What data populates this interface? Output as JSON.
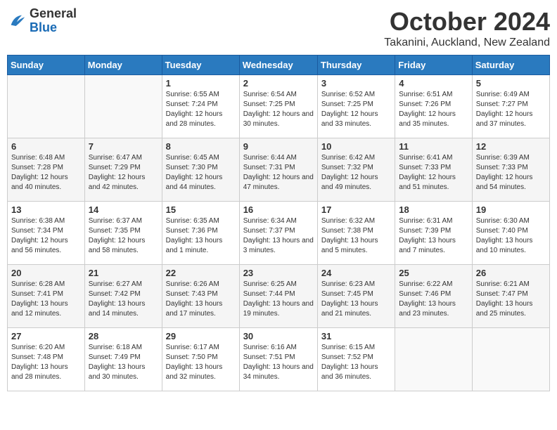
{
  "header": {
    "logo_general": "General",
    "logo_blue": "Blue",
    "month_title": "October 2024",
    "location": "Takanini, Auckland, New Zealand"
  },
  "weekdays": [
    "Sunday",
    "Monday",
    "Tuesday",
    "Wednesday",
    "Thursday",
    "Friday",
    "Saturday"
  ],
  "weeks": [
    [
      {
        "day": "",
        "sunrise": "",
        "sunset": "",
        "daylight": ""
      },
      {
        "day": "",
        "sunrise": "",
        "sunset": "",
        "daylight": ""
      },
      {
        "day": "1",
        "sunrise": "Sunrise: 6:55 AM",
        "sunset": "Sunset: 7:24 PM",
        "daylight": "Daylight: 12 hours and 28 minutes."
      },
      {
        "day": "2",
        "sunrise": "Sunrise: 6:54 AM",
        "sunset": "Sunset: 7:25 PM",
        "daylight": "Daylight: 12 hours and 30 minutes."
      },
      {
        "day": "3",
        "sunrise": "Sunrise: 6:52 AM",
        "sunset": "Sunset: 7:25 PM",
        "daylight": "Daylight: 12 hours and 33 minutes."
      },
      {
        "day": "4",
        "sunrise": "Sunrise: 6:51 AM",
        "sunset": "Sunset: 7:26 PM",
        "daylight": "Daylight: 12 hours and 35 minutes."
      },
      {
        "day": "5",
        "sunrise": "Sunrise: 6:49 AM",
        "sunset": "Sunset: 7:27 PM",
        "daylight": "Daylight: 12 hours and 37 minutes."
      }
    ],
    [
      {
        "day": "6",
        "sunrise": "Sunrise: 6:48 AM",
        "sunset": "Sunset: 7:28 PM",
        "daylight": "Daylight: 12 hours and 40 minutes."
      },
      {
        "day": "7",
        "sunrise": "Sunrise: 6:47 AM",
        "sunset": "Sunset: 7:29 PM",
        "daylight": "Daylight: 12 hours and 42 minutes."
      },
      {
        "day": "8",
        "sunrise": "Sunrise: 6:45 AM",
        "sunset": "Sunset: 7:30 PM",
        "daylight": "Daylight: 12 hours and 44 minutes."
      },
      {
        "day": "9",
        "sunrise": "Sunrise: 6:44 AM",
        "sunset": "Sunset: 7:31 PM",
        "daylight": "Daylight: 12 hours and 47 minutes."
      },
      {
        "day": "10",
        "sunrise": "Sunrise: 6:42 AM",
        "sunset": "Sunset: 7:32 PM",
        "daylight": "Daylight: 12 hours and 49 minutes."
      },
      {
        "day": "11",
        "sunrise": "Sunrise: 6:41 AM",
        "sunset": "Sunset: 7:33 PM",
        "daylight": "Daylight: 12 hours and 51 minutes."
      },
      {
        "day": "12",
        "sunrise": "Sunrise: 6:39 AM",
        "sunset": "Sunset: 7:33 PM",
        "daylight": "Daylight: 12 hours and 54 minutes."
      }
    ],
    [
      {
        "day": "13",
        "sunrise": "Sunrise: 6:38 AM",
        "sunset": "Sunset: 7:34 PM",
        "daylight": "Daylight: 12 hours and 56 minutes."
      },
      {
        "day": "14",
        "sunrise": "Sunrise: 6:37 AM",
        "sunset": "Sunset: 7:35 PM",
        "daylight": "Daylight: 12 hours and 58 minutes."
      },
      {
        "day": "15",
        "sunrise": "Sunrise: 6:35 AM",
        "sunset": "Sunset: 7:36 PM",
        "daylight": "Daylight: 13 hours and 1 minute."
      },
      {
        "day": "16",
        "sunrise": "Sunrise: 6:34 AM",
        "sunset": "Sunset: 7:37 PM",
        "daylight": "Daylight: 13 hours and 3 minutes."
      },
      {
        "day": "17",
        "sunrise": "Sunrise: 6:32 AM",
        "sunset": "Sunset: 7:38 PM",
        "daylight": "Daylight: 13 hours and 5 minutes."
      },
      {
        "day": "18",
        "sunrise": "Sunrise: 6:31 AM",
        "sunset": "Sunset: 7:39 PM",
        "daylight": "Daylight: 13 hours and 7 minutes."
      },
      {
        "day": "19",
        "sunrise": "Sunrise: 6:30 AM",
        "sunset": "Sunset: 7:40 PM",
        "daylight": "Daylight: 13 hours and 10 minutes."
      }
    ],
    [
      {
        "day": "20",
        "sunrise": "Sunrise: 6:28 AM",
        "sunset": "Sunset: 7:41 PM",
        "daylight": "Daylight: 13 hours and 12 minutes."
      },
      {
        "day": "21",
        "sunrise": "Sunrise: 6:27 AM",
        "sunset": "Sunset: 7:42 PM",
        "daylight": "Daylight: 13 hours and 14 minutes."
      },
      {
        "day": "22",
        "sunrise": "Sunrise: 6:26 AM",
        "sunset": "Sunset: 7:43 PM",
        "daylight": "Daylight: 13 hours and 17 minutes."
      },
      {
        "day": "23",
        "sunrise": "Sunrise: 6:25 AM",
        "sunset": "Sunset: 7:44 PM",
        "daylight": "Daylight: 13 hours and 19 minutes."
      },
      {
        "day": "24",
        "sunrise": "Sunrise: 6:23 AM",
        "sunset": "Sunset: 7:45 PM",
        "daylight": "Daylight: 13 hours and 21 minutes."
      },
      {
        "day": "25",
        "sunrise": "Sunrise: 6:22 AM",
        "sunset": "Sunset: 7:46 PM",
        "daylight": "Daylight: 13 hours and 23 minutes."
      },
      {
        "day": "26",
        "sunrise": "Sunrise: 6:21 AM",
        "sunset": "Sunset: 7:47 PM",
        "daylight": "Daylight: 13 hours and 25 minutes."
      }
    ],
    [
      {
        "day": "27",
        "sunrise": "Sunrise: 6:20 AM",
        "sunset": "Sunset: 7:48 PM",
        "daylight": "Daylight: 13 hours and 28 minutes."
      },
      {
        "day": "28",
        "sunrise": "Sunrise: 6:18 AM",
        "sunset": "Sunset: 7:49 PM",
        "daylight": "Daylight: 13 hours and 30 minutes."
      },
      {
        "day": "29",
        "sunrise": "Sunrise: 6:17 AM",
        "sunset": "Sunset: 7:50 PM",
        "daylight": "Daylight: 13 hours and 32 minutes."
      },
      {
        "day": "30",
        "sunrise": "Sunrise: 6:16 AM",
        "sunset": "Sunset: 7:51 PM",
        "daylight": "Daylight: 13 hours and 34 minutes."
      },
      {
        "day": "31",
        "sunrise": "Sunrise: 6:15 AM",
        "sunset": "Sunset: 7:52 PM",
        "daylight": "Daylight: 13 hours and 36 minutes."
      },
      {
        "day": "",
        "sunrise": "",
        "sunset": "",
        "daylight": ""
      },
      {
        "day": "",
        "sunrise": "",
        "sunset": "",
        "daylight": ""
      }
    ]
  ]
}
